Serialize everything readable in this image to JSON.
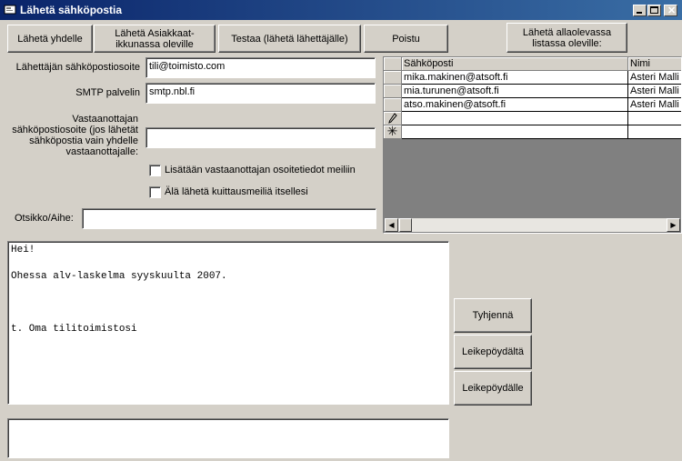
{
  "window": {
    "title": "Lähetä sähköpostia"
  },
  "toolbar": {
    "send_one": "Lähetä yhdelle",
    "send_customers": "Lähetä Asiakkaat-ikkunassa oleville",
    "test": "Testaa (lähetä lähettäjälle)",
    "exit": "Poistu",
    "send_list": "Lähetä allaolevassa listassa oleville:"
  },
  "form": {
    "sender_label": "Lähettäjän sähköpostiosoite",
    "sender_value": "tili@toimisto.com",
    "smtp_label": "SMTP palvelin",
    "smtp_value": "smtp.nbl.fi",
    "recipient_label": "Vastaanottajan sähköpostiosoite (jos lähetät sähköpostia vain yhdelle vastaanottajalle:",
    "recipient_value": "",
    "add_address_label": "Lisätään vastaanottajan osoitetiedot meiliin",
    "no_receipt_label": "Älä lähetä kuittausmeiliä itsellesi",
    "subject_label": "Otsikko/Aihe:",
    "subject_value": ""
  },
  "grid": {
    "columns": [
      "Sähköposti",
      "Nimi"
    ],
    "rows": [
      [
        "mika.makinen@atsoft.fi",
        "Asteri Malli"
      ],
      [
        "mia.turunen@atsoft.fi",
        "Asteri Malli"
      ],
      [
        "atso.makinen@atsoft.fi",
        "Asteri Malli"
      ]
    ]
  },
  "message": {
    "lines": [
      "Hei!",
      "",
      "Ohessa alv-laskelma syyskuulta 2007.",
      "",
      "",
      "",
      "t. Oma tilitoimistosi"
    ]
  },
  "side_buttons": {
    "clear": "Tyhjennä",
    "from_clipboard": "Leikepöydältä",
    "to_clipboard": "Leikepöydälle"
  },
  "colors": {
    "titlebar": "#0a246a",
    "face": "#d4d0c8"
  }
}
